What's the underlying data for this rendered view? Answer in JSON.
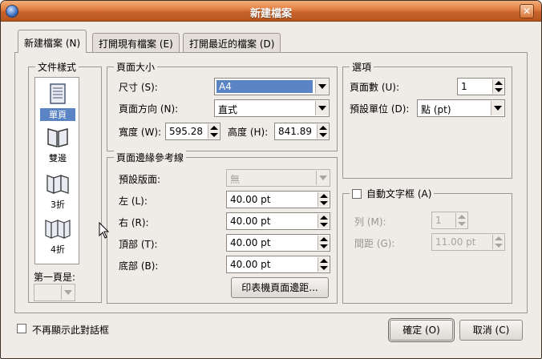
{
  "window": {
    "title": "新建檔案"
  },
  "tabs": [
    {
      "label": "新建檔案 (N)"
    },
    {
      "label": "打開現有檔案 (E)"
    },
    {
      "label": "打開最近的檔案 (D)"
    }
  ],
  "doc_style": {
    "title": "文件樣式",
    "items": [
      {
        "label": "單頁"
      },
      {
        "label": "雙邊"
      },
      {
        "label": "3折"
      },
      {
        "label": "4折"
      }
    ],
    "first_page_label": "第一頁是:",
    "first_page_value": ""
  },
  "page_size": {
    "title": "頁面大小",
    "size_label": "尺寸 (S):",
    "size_value": "A4",
    "orientation_label": "頁面方向 (N):",
    "orientation_value": "直式",
    "width_label": "寬度 (W):",
    "width_value": "595.28",
    "height_label": "高度 (H):",
    "height_value": "841.89"
  },
  "margins": {
    "title": "頁面邊緣參考線",
    "preset_label": "預設版面:",
    "preset_value": "無",
    "left_label": "左 (L):",
    "left_value": "40.00 pt",
    "right_label": "右 (R):",
    "right_value": "40.00 pt",
    "top_label": "頂部 (T):",
    "top_value": "40.00 pt",
    "bottom_label": "底部 (B):",
    "bottom_value": "40.00 pt",
    "printer_button": "印表機頁面邊距..."
  },
  "options": {
    "title": "選項",
    "pages_label": "頁面數 (U):",
    "pages_value": "1",
    "unit_label": "預設單位 (D):",
    "unit_value": "點 (pt)"
  },
  "auto_text": {
    "title": "自動文字框 (A)",
    "columns_label": "列 (M):",
    "columns_value": "1",
    "gap_label": "間距 (G):",
    "gap_value": "11.00 pt"
  },
  "footer": {
    "dont_show_label": "不再顯示此對話框",
    "ok_label": "確定 (O)",
    "cancel_label": "取消 (C)"
  }
}
